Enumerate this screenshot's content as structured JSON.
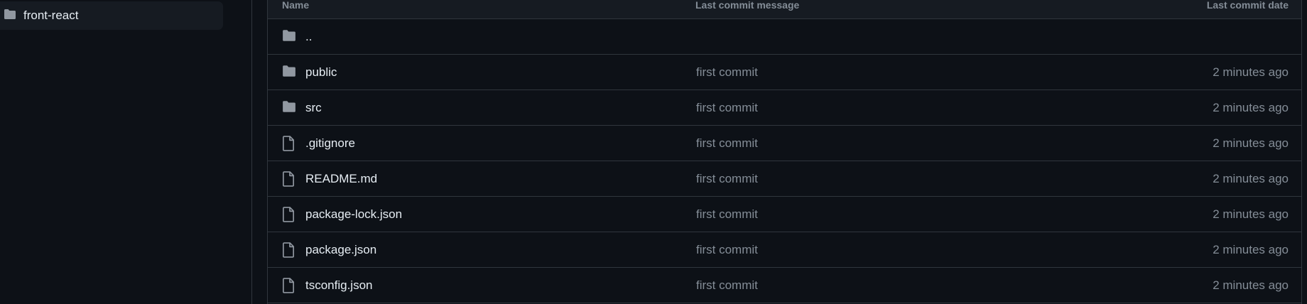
{
  "sidebar": {
    "items": [
      {
        "label": "front-react",
        "icon": "folder-icon"
      }
    ]
  },
  "table": {
    "headers": {
      "name": "Name",
      "message": "Last commit message",
      "date": "Last commit date"
    },
    "rows": [
      {
        "type": "folder",
        "name": "..",
        "message": "",
        "date": ""
      },
      {
        "type": "folder",
        "name": "public",
        "message": "first commit",
        "date": "2 minutes ago"
      },
      {
        "type": "folder",
        "name": "src",
        "message": "first commit",
        "date": "2 minutes ago"
      },
      {
        "type": "file",
        "name": ".gitignore",
        "message": "first commit",
        "date": "2 minutes ago"
      },
      {
        "type": "file",
        "name": "README.md",
        "message": "first commit",
        "date": "2 minutes ago"
      },
      {
        "type": "file",
        "name": "package-lock.json",
        "message": "first commit",
        "date": "2 minutes ago"
      },
      {
        "type": "file",
        "name": "package.json",
        "message": "first commit",
        "date": "2 minutes ago"
      },
      {
        "type": "file",
        "name": "tsconfig.json",
        "message": "first commit",
        "date": "2 minutes ago"
      }
    ]
  },
  "colors": {
    "background": "#0d1117",
    "surface": "#161b22",
    "border": "#30363d",
    "text_primary": "#e6edf3",
    "text_muted": "#848d97",
    "icon": "#9198a1"
  }
}
